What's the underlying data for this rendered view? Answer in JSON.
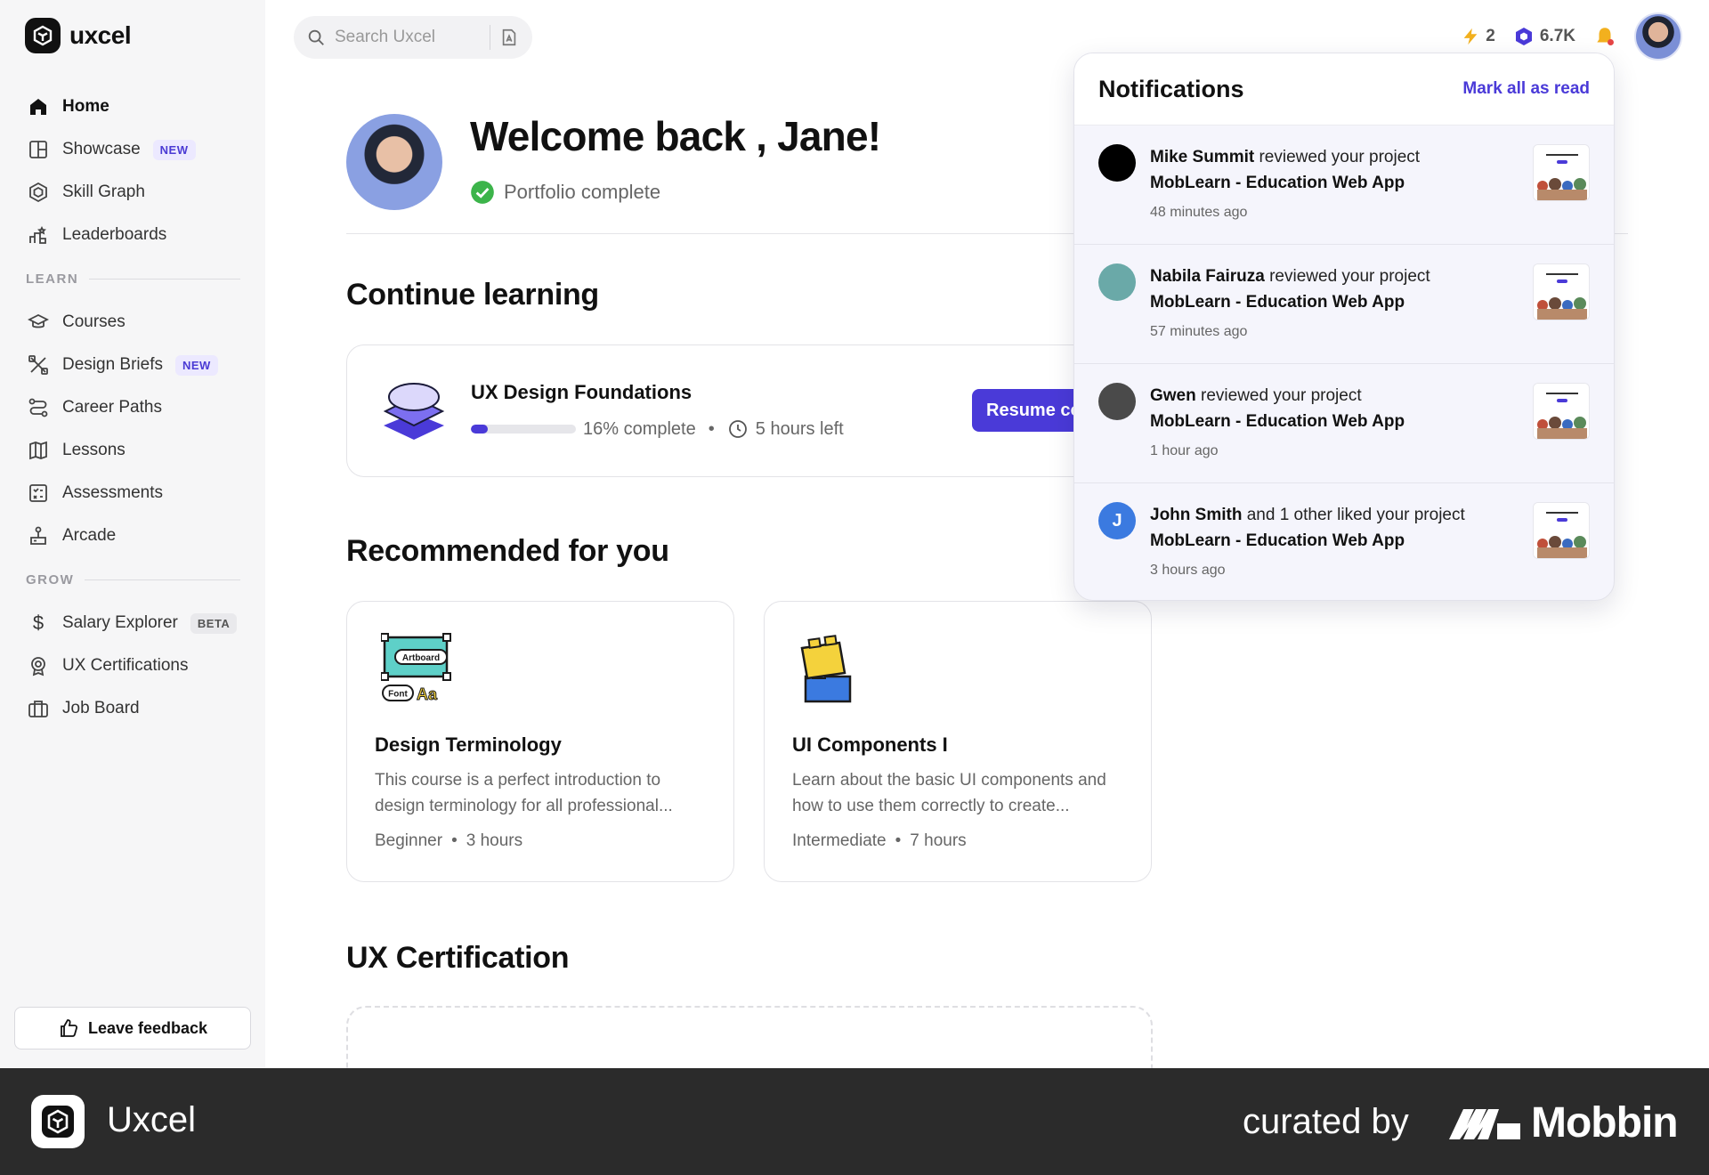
{
  "app": {
    "name": "uxcel"
  },
  "sidebar": {
    "items": [
      {
        "label": "Home",
        "icon": "home-icon"
      },
      {
        "label": "Showcase",
        "tag": "NEW",
        "icon": "showcase-icon"
      },
      {
        "label": "Skill Graph",
        "icon": "skill-graph-icon"
      },
      {
        "label": "Leaderboards",
        "icon": "leaderboards-icon"
      }
    ],
    "learn_label": "LEARN",
    "learn_items": [
      {
        "label": "Courses",
        "icon": "courses-icon"
      },
      {
        "label": "Design Briefs",
        "tag": "NEW",
        "icon": "design-briefs-icon"
      },
      {
        "label": "Career Paths",
        "icon": "career-paths-icon"
      },
      {
        "label": "Lessons",
        "icon": "lessons-icon"
      },
      {
        "label": "Assessments",
        "icon": "assessments-icon"
      },
      {
        "label": "Arcade",
        "icon": "arcade-icon"
      }
    ],
    "grow_label": "GROW",
    "grow_items": [
      {
        "label": "Salary Explorer",
        "tag": "BETA",
        "icon": "dollar-icon"
      },
      {
        "label": "UX Certifications",
        "icon": "certification-icon"
      },
      {
        "label": "Job Board",
        "icon": "briefcase-icon"
      }
    ],
    "feedback_label": "Leave feedback"
  },
  "topbar": {
    "search_placeholder": "Search Uxcel",
    "streak": "2",
    "points": "6.7K"
  },
  "welcome": {
    "title": "Welcome back , Jane!",
    "portfolio_status": "Portfolio complete"
  },
  "continue_learning": {
    "heading": "Continue learning",
    "course_title": "UX Design Foundations",
    "progress_percent": 16,
    "progress_text": "16% complete",
    "time_left": "5 hours left",
    "resume_label": "Resume co"
  },
  "recommended": {
    "heading": "Recommended for you",
    "cards": [
      {
        "title": "Design Terminology",
        "desc": "This course is a perfect introduction to design terminology for all professional...",
        "level": "Beginner",
        "duration": "3 hours",
        "thumb_labels": [
          "Artboard",
          "Font",
          "Aa"
        ]
      },
      {
        "title": "UI Components I",
        "desc": "Learn about the basic UI components and how to use them correctly to create...",
        "level": "Intermediate",
        "duration": "7 hours"
      }
    ]
  },
  "certification": {
    "heading": "UX Certification"
  },
  "notifications": {
    "title": "Notifications",
    "mark_all": "Mark all as read",
    "items": [
      {
        "actor": "Mike Summit",
        "action": " reviewed your project",
        "project": "MobLearn - Education Web App",
        "time": "48 minutes ago",
        "avatar_color": "#000000",
        "initial": ""
      },
      {
        "actor": "Nabila Fairuza",
        "action": " reviewed your project",
        "project": "MobLearn - Education Web App",
        "time": "57 minutes ago",
        "avatar_color": "#6aa9a8",
        "initial": ""
      },
      {
        "actor": "Gwen",
        "action": " reviewed your project ",
        "project": "MobLearn - Education Web App",
        "time": "1 hour ago",
        "avatar_color": "#4a4a4a",
        "initial": ""
      },
      {
        "actor": "John Smith",
        "action": " and 1 other liked your project",
        "project": "MobLearn - Education Web App",
        "time": "3 hours ago",
        "avatar_color": "#3b7ae0",
        "initial": "J"
      }
    ]
  },
  "footer": {
    "app_name": "Uxcel",
    "curated_by": "curated by",
    "brand": "Mobbin"
  },
  "colors": {
    "accent": "#4a3ad8",
    "success": "#3cb44a",
    "footer_bg": "#2b2b2b"
  }
}
